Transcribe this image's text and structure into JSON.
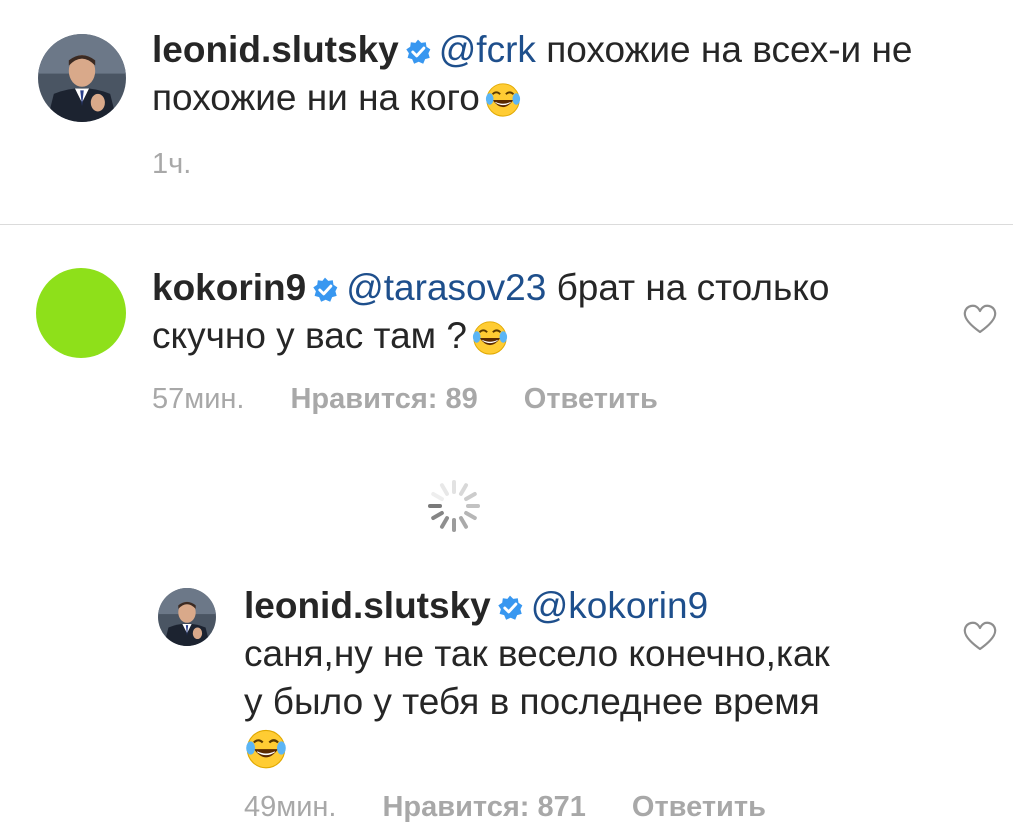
{
  "comments": [
    {
      "username": "leonid.slutsky",
      "mention": "@fcrk",
      "text_line1": "похожие на всех-и не",
      "text_line2": "похожие ни на кого",
      "time": "1ч.",
      "emoji": "face-with-tears-of-joy",
      "verified": true
    },
    {
      "username": "kokorin9",
      "mention": "@tarasov23",
      "text_line1": "брат на столько",
      "text_line2": "скучно у вас там ?",
      "time": "57мин.",
      "likes": "Нравится: 89",
      "reply": "Ответить",
      "emoji": "face-with-tears-of-joy",
      "verified": true,
      "avatar_color": "#8ee01a"
    },
    {
      "username": "leonid.slutsky",
      "mention": "@kokorin9",
      "text_line1": "саня,ну не так весело конечно,как",
      "text_line2": "у было у тебя в последнее время",
      "time": "49мин.",
      "likes": "Нравится: 871",
      "reply": "Ответить",
      "emoji": "face-with-tears-of-joy",
      "verified": true
    }
  ],
  "icons": {
    "verified": "verified-badge-icon",
    "like": "heart-outline-icon",
    "loading": "loading-spinner-icon"
  },
  "colors": {
    "text": "#262626",
    "mention": "#1e4f8c",
    "meta": "#a8a8a8",
    "verified_badge": "#3897f0",
    "divider": "#dbdbdb"
  }
}
